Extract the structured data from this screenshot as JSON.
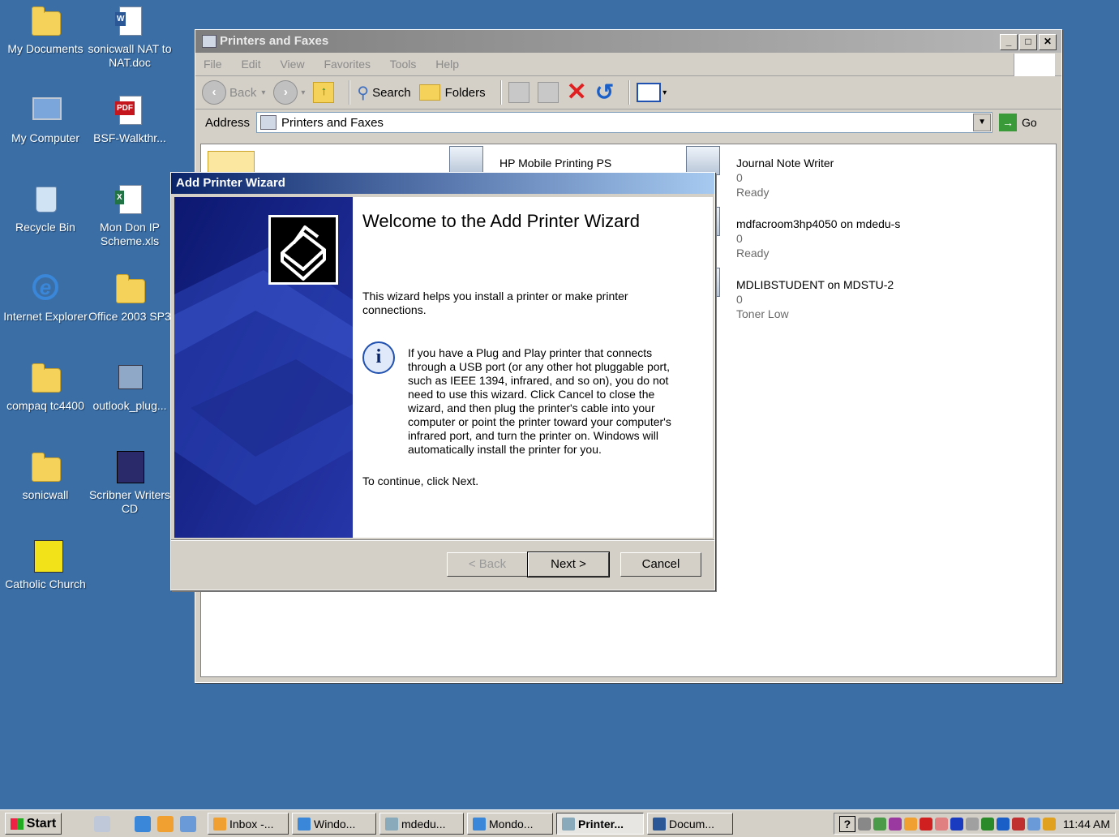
{
  "desktop": {
    "icons": [
      {
        "label": "My Documents"
      },
      {
        "label": "sonicwall NAT to NAT.doc"
      },
      {
        "label": "My Computer"
      },
      {
        "label": "BSF-Walkthr..."
      },
      {
        "label": "Recycle Bin"
      },
      {
        "label": "Mon Don IP Scheme.xls"
      },
      {
        "label": "Internet Explorer"
      },
      {
        "label": "Office 2003 SP3"
      },
      {
        "label": "compaq tc4400"
      },
      {
        "label": "outlook_plug..."
      },
      {
        "label": "sonicwall"
      },
      {
        "label": "Scribner Writers CD"
      },
      {
        "label": "Catholic Church"
      }
    ]
  },
  "explorer": {
    "title": "Printers and Faxes",
    "menu": [
      "File",
      "Edit",
      "View",
      "Favorites",
      "Tools",
      "Help"
    ],
    "toolbar": {
      "back": "Back",
      "search": "Search",
      "folders": "Folders"
    },
    "address_label": "Address",
    "address_value": "Printers and Faxes",
    "go": "Go",
    "printers": [
      {
        "name": "HP Mobile Printing PS",
        "docs": "",
        "status": ""
      },
      {
        "name": "Journal Note Writer",
        "docs": "0",
        "status": "Ready"
      },
      {
        "name": "mdfacroom3hp4050 on mdedu-s",
        "docs": "0",
        "status": "Ready"
      },
      {
        "name": "MDLIBSTUDENT on MDSTU-2",
        "docs": "0",
        "status": "Toner Low"
      }
    ]
  },
  "wizard": {
    "title": "Add Printer Wizard",
    "heading": "Welcome to the Add Printer Wizard",
    "intro": "This wizard helps you install a printer or make printer connections.",
    "info": "If you have a Plug and Play printer that connects through a USB port (or any other hot pluggable port, such as IEEE 1394, infrared, and so on), you do not need to use this wizard. Click Cancel to close the wizard, and then plug the printer's cable into your computer or point the printer toward your computer's infrared port, and turn the printer on. Windows will automatically install the printer for you.",
    "continue": "To continue, click Next.",
    "buttons": {
      "back": "< Back",
      "next": "Next >",
      "cancel": "Cancel"
    }
  },
  "taskbar": {
    "start": "Start",
    "tasks": [
      "Inbox -...",
      "Windo...",
      "mdedu...",
      "Mondo...",
      "Printer...",
      "Docum..."
    ],
    "active_task": "Printer...",
    "tray_help": "?",
    "clock": "11:44 AM"
  }
}
